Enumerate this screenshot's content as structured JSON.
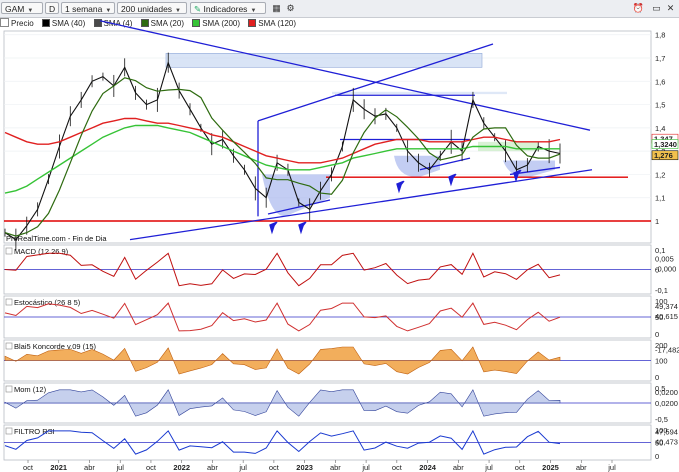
{
  "toolbar": {
    "symbol": "GAM",
    "period_letter": "D",
    "timeframe": "1 semana",
    "units": "200 unidades",
    "indicators": "Indicadores"
  },
  "legend": {
    "price": "Precio",
    "ma": [
      {
        "label": "SMA (40)",
        "color": "#000000"
      },
      {
        "label": "SMA (4)",
        "color": "#4a4a4a"
      },
      {
        "label": "SMA (20)",
        "color": "#2e6b10"
      },
      {
        "label": "SMA (200)",
        "color": "#36c336"
      },
      {
        "label": "SMA (120)",
        "color": "#e02020"
      }
    ]
  },
  "watermark": "ProRealTime.com - Fin de Dia",
  "panels": {
    "macd": "MACD (12 26 9)",
    "stoch": "Estocástico (26 8 5)",
    "koncorde": "Blai5 Koncorde v.09 (15)",
    "mom": "Mom (12)",
    "rsi": "FILTRO RSI"
  },
  "chart_data": {
    "type": "line",
    "title": "GAM",
    "x_ticks": [
      "oct",
      "2021",
      "abr",
      "jul",
      "oct",
      "2022",
      "abr",
      "jul",
      "oct",
      "2023",
      "abr",
      "jul",
      "oct",
      "2024",
      "abr",
      "jul",
      "oct",
      "2025",
      "abr",
      "jul"
    ],
    "price": {
      "y_ticks": [
        "1,8",
        "1,7",
        "1,6",
        "1,5",
        "1,4",
        "1,3",
        "1,2",
        "1,1",
        "1"
      ],
      "ylim": [
        0.85,
        1.85
      ],
      "last_value_labels": [
        "1,347",
        "1,3240",
        "1,276"
      ],
      "series": [
        {
          "name": "Precio",
          "values": [
            0.95,
            0.92,
            0.98,
            1.05,
            1.18,
            1.32,
            1.45,
            1.52,
            1.6,
            1.62,
            1.58,
            1.66,
            1.55,
            1.5,
            1.52,
            1.68,
            1.56,
            1.48,
            1.4,
            1.33,
            1.35,
            1.28,
            1.22,
            1.14,
            1.1,
            1.25,
            1.22,
            1.08,
            1.05,
            1.13,
            1.2,
            1.32,
            1.52,
            1.48,
            1.45,
            1.46,
            1.4,
            1.3,
            1.25,
            1.22,
            1.28,
            1.34,
            1.3,
            1.52,
            1.42,
            1.36,
            1.3,
            1.22,
            1.24,
            1.32,
            1.3,
            1.29
          ]
        },
        {
          "name": "SMA (120)",
          "values": [
            1.38,
            1.36,
            1.34,
            1.33,
            1.33,
            1.34,
            1.36,
            1.38,
            1.4,
            1.42,
            1.43,
            1.44,
            1.44,
            1.43,
            1.42,
            1.42,
            1.41,
            1.4,
            1.39,
            1.37,
            1.36,
            1.34,
            1.32,
            1.3,
            1.28,
            1.27,
            1.26,
            1.25,
            1.25,
            1.25,
            1.26,
            1.27,
            1.29,
            1.31,
            1.33,
            1.34,
            1.35,
            1.35,
            1.35,
            1.34,
            1.34,
            1.34,
            1.34,
            1.35,
            1.36,
            1.36,
            1.35,
            1.34,
            1.34,
            1.34,
            1.34,
            1.35
          ]
        },
        {
          "name": "SMA (200)",
          "values": [
            1.12,
            1.13,
            1.15,
            1.18,
            1.21,
            1.24,
            1.27,
            1.3,
            1.33,
            1.36,
            1.38,
            1.4,
            1.41,
            1.41,
            1.41,
            1.4,
            1.39,
            1.38,
            1.36,
            1.34,
            1.32,
            1.3,
            1.28,
            1.26,
            1.24,
            1.23,
            1.22,
            1.22,
            1.22,
            1.23,
            1.24,
            1.25,
            1.27,
            1.28,
            1.29,
            1.3,
            1.31,
            1.31,
            1.31,
            1.31,
            1.31,
            1.31,
            1.31,
            1.32,
            1.32,
            1.32,
            1.32,
            1.31,
            1.31,
            1.31,
            1.31,
            1.31
          ]
        }
      ]
    },
    "macd": {
      "y_ticks": [
        "0,1",
        "0",
        "-0,1"
      ],
      "last_value_labels": [
        "0,005",
        "-0,000"
      ]
    },
    "stoch": {
      "y_ticks": [
        "100",
        "50",
        "0"
      ],
      "last_value_labels": [
        "49,374",
        "40,615"
      ]
    },
    "koncorde": {
      "y_ticks": [
        "200",
        "100",
        "0"
      ],
      "last_value_labels": [
        "-17,482"
      ]
    },
    "mom": {
      "y_ticks": [
        "0,5",
        "0,0200",
        "-0,5"
      ],
      "last_value_labels": [
        "0,0200"
      ]
    },
    "rsi": {
      "y_ticks": [
        "100",
        "50",
        "0"
      ],
      "last_value_labels": [
        "47,594",
        "40,473"
      ]
    }
  },
  "colors": {
    "accent_line": "#1f1fd6",
    "support_red": "#e00000",
    "ma_green": "#36c336",
    "ma_red": "#e02020"
  }
}
